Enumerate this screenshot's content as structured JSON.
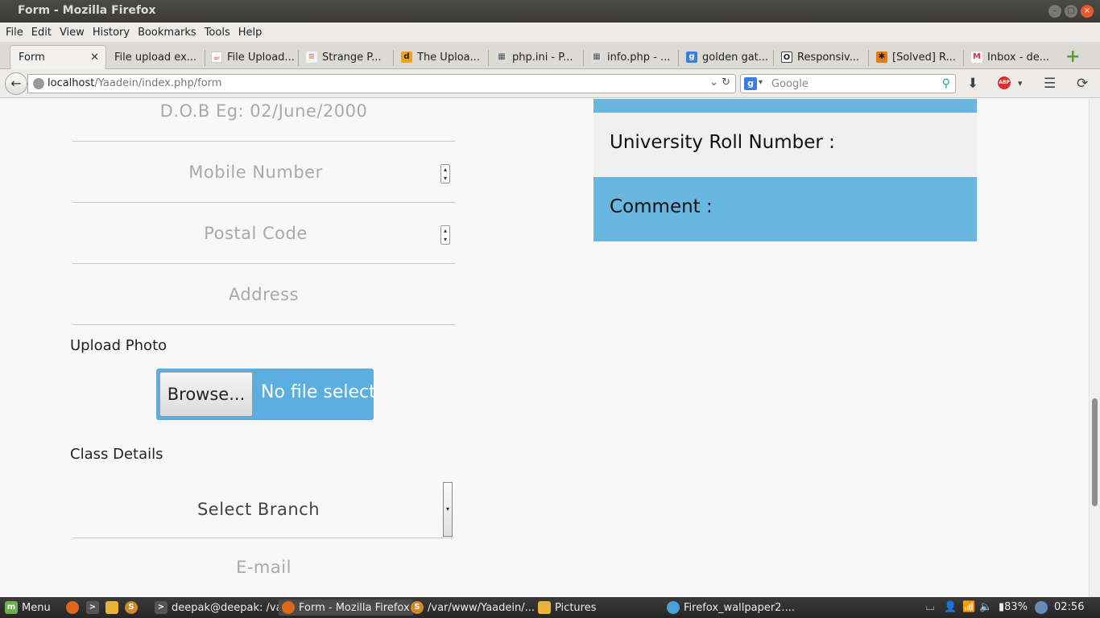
{
  "window": {
    "title": "Form - Mozilla Firefox"
  },
  "menubar": [
    "File",
    "Edit",
    "View",
    "History",
    "Bookmarks",
    "Tools",
    "Help"
  ],
  "tabs": [
    {
      "label": "Form",
      "icon": "blank-page-icon",
      "active": true
    },
    {
      "label": "File upload ex...",
      "icon": "none"
    },
    {
      "label": "File Upload...",
      "icon": "java-icon"
    },
    {
      "label": "Strange P...",
      "icon": "stackoverflow-icon"
    },
    {
      "label": "The Uploa...",
      "icon": "d-icon"
    },
    {
      "label": "php.ini - P...",
      "icon": "php-icon"
    },
    {
      "label": "info.php - ...",
      "icon": "php-icon"
    },
    {
      "label": "golden gat...",
      "icon": "google-icon"
    },
    {
      "label": "Responsiv...",
      "icon": "o-icon"
    },
    {
      "label": "[Solved] R...",
      "icon": "asterisk-icon"
    },
    {
      "label": "Inbox - de...",
      "icon": "gmail-icon"
    }
  ],
  "navbar": {
    "url_host": "localhost",
    "url_path": "/Yaadein/index.php/form",
    "search_placeholder": "Google"
  },
  "form": {
    "dob_placeholder": "D.O.B Eg: 02/June/2000",
    "mobile_placeholder": "Mobile Number",
    "postal_placeholder": "Postal Code",
    "address_placeholder": "Address",
    "upload_label": "Upload Photo",
    "browse_label": "Browse...",
    "no_file_text": "No file selected.",
    "class_details_label": "Class Details",
    "branch_select_value": "Select Branch",
    "email_placeholder": "E-mail"
  },
  "preview": {
    "roll_number_label": "University Roll Number :",
    "comment_label": "Comment :"
  },
  "taskbar": {
    "menu_label": "Menu",
    "items": [
      "deepak@deepak: /va...",
      "Form - Mozilla Firefox",
      "/var/www/Yaadein/...",
      "Pictures",
      "Firefox_wallpaper2...."
    ],
    "battery": "83%",
    "clock": "02:56"
  },
  "colors": {
    "accent_blue": "#69b7e0",
    "upload_blue": "#5aafe0"
  }
}
